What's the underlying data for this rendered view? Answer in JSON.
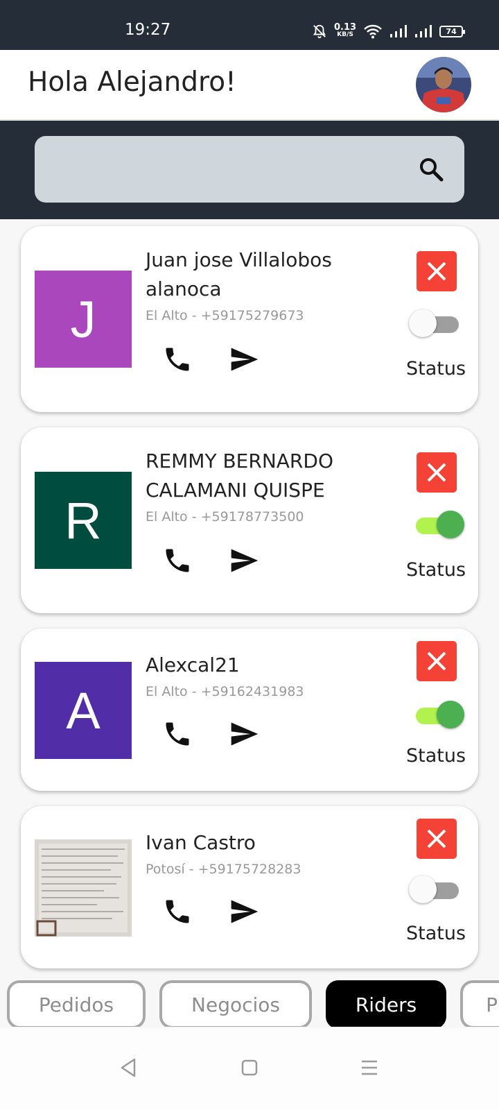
{
  "status_bar": {
    "time": "19:27",
    "net_speed_value": "0.13",
    "net_speed_unit": "KB/S",
    "battery": "74",
    "icons": [
      "bell-muted-icon",
      "wifi-icon",
      "signal-icon",
      "signal-icon",
      "battery-icon"
    ]
  },
  "header": {
    "greeting": "Hola Alejandro!"
  },
  "search": {
    "icon": "search-icon",
    "value": ""
  },
  "riders": [
    {
      "initial": "J",
      "tile_color": "#ab47bc",
      "name": "Juan jose Villalobos alanoca",
      "meta": "El Alto - +59175279673",
      "status_on": false,
      "status_label": "Status"
    },
    {
      "initial": "R",
      "tile_color": "#004d40",
      "name": "REMMY BERNARDO CALAMANI QUISPE",
      "meta": "El Alto - +59178773500",
      "status_on": true,
      "status_label": "Status"
    },
    {
      "initial": "A",
      "tile_color": "#512da8",
      "name": "Alexcal21",
      "meta": "El Alto - +59162431983",
      "status_on": true,
      "status_label": "Status"
    },
    {
      "initial": "",
      "tile_color": "#d9d6d2",
      "photo": "document-photo",
      "name": "Ivan Castro",
      "meta": "Potosí - +59175728283",
      "status_on": false,
      "status_label": "Status"
    }
  ],
  "tabs": [
    {
      "label": "Pedidos",
      "active": false
    },
    {
      "label": "Negocios",
      "active": false
    },
    {
      "label": "Riders",
      "active": true
    },
    {
      "label": "P",
      "active": false
    }
  ],
  "colors": {
    "dark_band": "#252e38",
    "search_bg": "#cfd6dc",
    "close_red": "#f44336",
    "toggle_on_knob": "#4caf50",
    "toggle_on_track": "#b2f24e"
  },
  "nav_icons": [
    "back-icon",
    "home-icon",
    "menu-icon"
  ]
}
